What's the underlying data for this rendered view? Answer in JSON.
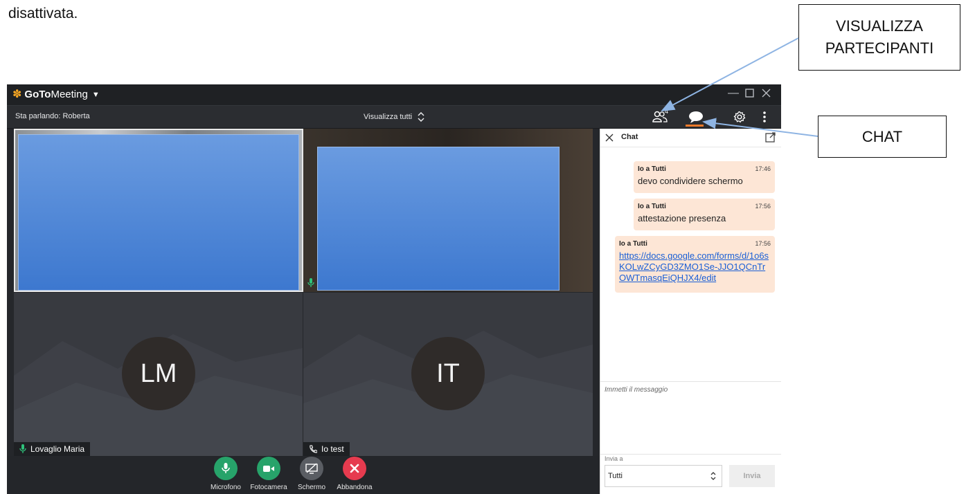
{
  "document": {
    "text": "disattivata."
  },
  "callouts": {
    "participants_line1": "VISUALIZZA",
    "participants_line2": "PARTECIPANTI",
    "chat": "CHAT"
  },
  "app": {
    "logo_bold": "GoTo",
    "logo_rest": "Meeting",
    "speaking": "Sta parlando: Roberta",
    "view_all": "Visualizza tutti",
    "participant_count": "4"
  },
  "tiles": [
    {
      "initials": "LM",
      "name": "Lovaglio Maria"
    },
    {
      "initials": "IT",
      "name": "Io test"
    }
  ],
  "controls": {
    "mic": "Microfono",
    "camera": "Fotocamera",
    "screen": "Schermo",
    "leave": "Abbandona"
  },
  "colors": {
    "mic": "#27a36a",
    "camera": "#27a36a",
    "screen": "#5a5d63",
    "leave": "#e63b4f",
    "accent": "#f07a2a"
  },
  "chat": {
    "title": "Chat",
    "messages": [
      {
        "from": "Io a Tutti",
        "time": "17:46",
        "text": "devo condividere schermo"
      },
      {
        "from": "Io a Tutti",
        "time": "17:56",
        "text": "attestazione presenza"
      },
      {
        "from": "Io a Tutti",
        "time": "17:56",
        "text": "https://docs.google.com/forms/d/1o6sKOLwZCyGD3ZMO1Se-JJO1QCnTrOWTmasqEiQHJX4/edit"
      }
    ],
    "input_placeholder": "Immetti il messaggio",
    "send_to_label": "Invia a",
    "send_to_value": "Tutti",
    "send_label": "Invia"
  }
}
